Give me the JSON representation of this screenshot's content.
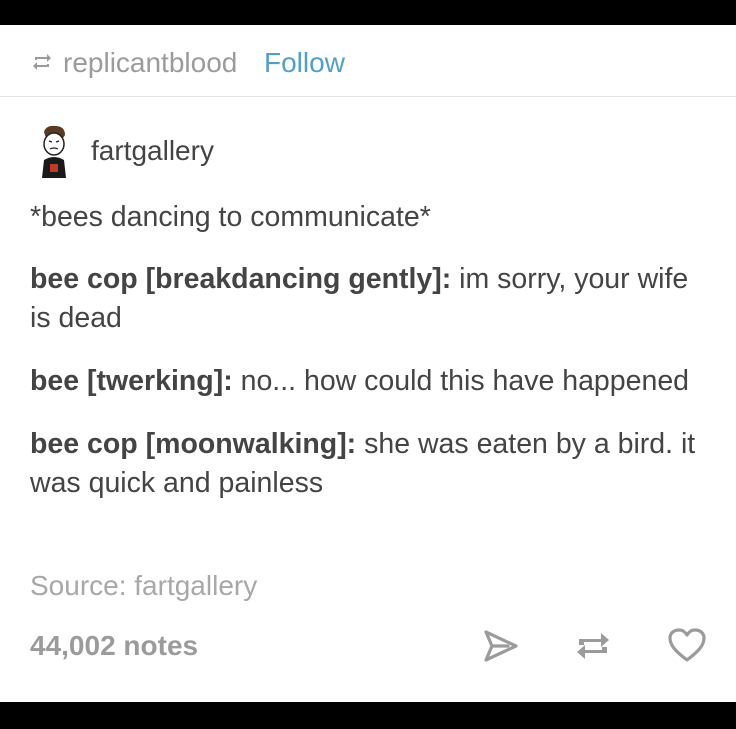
{
  "header": {
    "reblogged_from": "replicantblood",
    "follow_label": "Follow"
  },
  "post": {
    "author": "fartgallery",
    "lines": [
      {
        "speaker": "",
        "text": "*bees dancing to communicate*"
      },
      {
        "speaker": "bee cop [breakdancing gently]:",
        "text": " im sorry, your wife is dead"
      },
      {
        "speaker": "bee [twerking]:",
        "text": " no... how could this have happened"
      },
      {
        "speaker": "bee cop [moonwalking]:",
        "text": " she was eaten by a bird. it was quick and painless"
      }
    ],
    "source": "Source: fartgallery"
  },
  "footer": {
    "notes": "44,002 notes",
    "actions": [
      "share-icon",
      "reblog-icon",
      "heart-icon"
    ]
  },
  "colors": {
    "link": "#529ecc",
    "text": "#444444",
    "muted": "#9b9b9b"
  }
}
